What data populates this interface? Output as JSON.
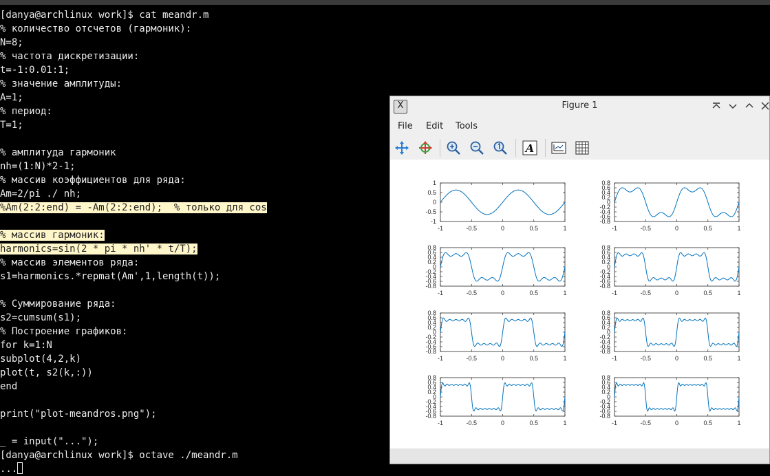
{
  "terminal": {
    "lines": [
      {
        "text": "[danya@archlinux work]$ cat meandr.m"
      },
      {
        "text": "% количество отсчетов (гармоник):"
      },
      {
        "text": "N=8;"
      },
      {
        "text": "% частота дискретизации:"
      },
      {
        "text": "t=-1:0.01:1;"
      },
      {
        "text": "% значение амплитуды:"
      },
      {
        "text": "A=1;"
      },
      {
        "text": "% период:"
      },
      {
        "text": "T=1;"
      },
      {
        "text": ""
      },
      {
        "text": "% амплитуда гармоник"
      },
      {
        "text": "nh=(1:N)*2-1;"
      },
      {
        "text": "% массив коэффициентов для ряда:"
      },
      {
        "text": "Am=2/pi ./ nh;"
      },
      {
        "text": "%Am(2:2:end) = -Am(2:2:end);  % только для cos",
        "hl": true
      },
      {
        "text": ""
      },
      {
        "text": "% массив гармоник:",
        "hl": true
      },
      {
        "text": "harmonics=sin(2 * pi * nh' * t/T);",
        "hl": true
      },
      {
        "text": "% массив элементов ряда:"
      },
      {
        "text": "s1=harmonics.*repmat(Am',1,length(t));"
      },
      {
        "text": ""
      },
      {
        "text": "% Суммирование ряда:"
      },
      {
        "text": "s2=cumsum(s1);"
      },
      {
        "text": "% Построение графиков:"
      },
      {
        "text": "for k=1:N"
      },
      {
        "text": "subplot(4,2,k)"
      },
      {
        "text": "plot(t, s2(k,:))"
      },
      {
        "text": "end"
      },
      {
        "text": ""
      },
      {
        "text": "print(\"plot-meandros.png\");"
      },
      {
        "text": ""
      },
      {
        "text": "_ = input(\"...\");"
      },
      {
        "text": "[danya@archlinux work]$ octave ./meandr.m"
      },
      {
        "text": "...",
        "cursor": true
      }
    ]
  },
  "figure": {
    "title": "Figure 1",
    "app_icon_glyph": "X",
    "menu": [
      "File",
      "Edit",
      "Tools"
    ],
    "toolbar_icons": [
      "pan-icon",
      "rotate-icon",
      "zoom-in-icon",
      "zoom-out-icon",
      "autoscale-icon",
      "insert-text-icon",
      "axes-toggle-icon",
      "grid-toggle-icon"
    ],
    "line_color": "#0072bd"
  },
  "chart_data": {
    "type": "line",
    "layout": "4x2 subplots",
    "function": "partial Fourier sum of square wave, harmonics 1..k (odd), amplitude 2/(pi*n)",
    "x_range": [
      -1,
      1
    ],
    "x_ticks": [
      "-1",
      "-0.5",
      "0",
      "0.5",
      "1"
    ],
    "series": [
      {
        "k": 1,
        "ylim": [
          -1,
          1
        ],
        "y_ticks": [
          "1",
          "0.5",
          "0",
          "-0.5",
          "-1"
        ]
      },
      {
        "k": 2,
        "ylim": [
          -0.8,
          0.8
        ],
        "y_ticks": [
          "0.8",
          "0.6",
          "0.4",
          "0.2",
          "0",
          "-0.2",
          "-0.4",
          "-0.6",
          "-0.8"
        ]
      },
      {
        "k": 3,
        "ylim": [
          -0.8,
          0.8
        ],
        "y_ticks": [
          "0.8",
          "0.6",
          "0.4",
          "0.2",
          "0",
          "-0.2",
          "-0.4",
          "-0.6",
          "-0.8"
        ]
      },
      {
        "k": 4,
        "ylim": [
          -0.8,
          0.8
        ],
        "y_ticks": [
          "0.8",
          "0.6",
          "0.4",
          "0.2",
          "0",
          "-0.2",
          "-0.4",
          "-0.6",
          "-0.8"
        ]
      },
      {
        "k": 5,
        "ylim": [
          -0.8,
          0.8
        ],
        "y_ticks": [
          "0.8",
          "0.6",
          "0.4",
          "0.2",
          "0",
          "-0.2",
          "-0.4",
          "-0.6",
          "-0.8"
        ]
      },
      {
        "k": 6,
        "ylim": [
          -0.8,
          0.8
        ],
        "y_ticks": [
          "0.8",
          "0.6",
          "0.4",
          "0.2",
          "0",
          "-0.2",
          "-0.4",
          "-0.6",
          "-0.8"
        ]
      },
      {
        "k": 7,
        "ylim": [
          -0.8,
          0.8
        ],
        "y_ticks": [
          "0.8",
          "0.6",
          "0.4",
          "0.2",
          "0",
          "-0.2",
          "-0.4",
          "-0.6",
          "-0.8"
        ]
      },
      {
        "k": 8,
        "ylim": [
          -0.8,
          0.8
        ],
        "y_ticks": [
          "0.8",
          "0.6",
          "0.4",
          "0.2",
          "0",
          "-0.2",
          "-0.4",
          "-0.6",
          "-0.8"
        ]
      }
    ]
  }
}
